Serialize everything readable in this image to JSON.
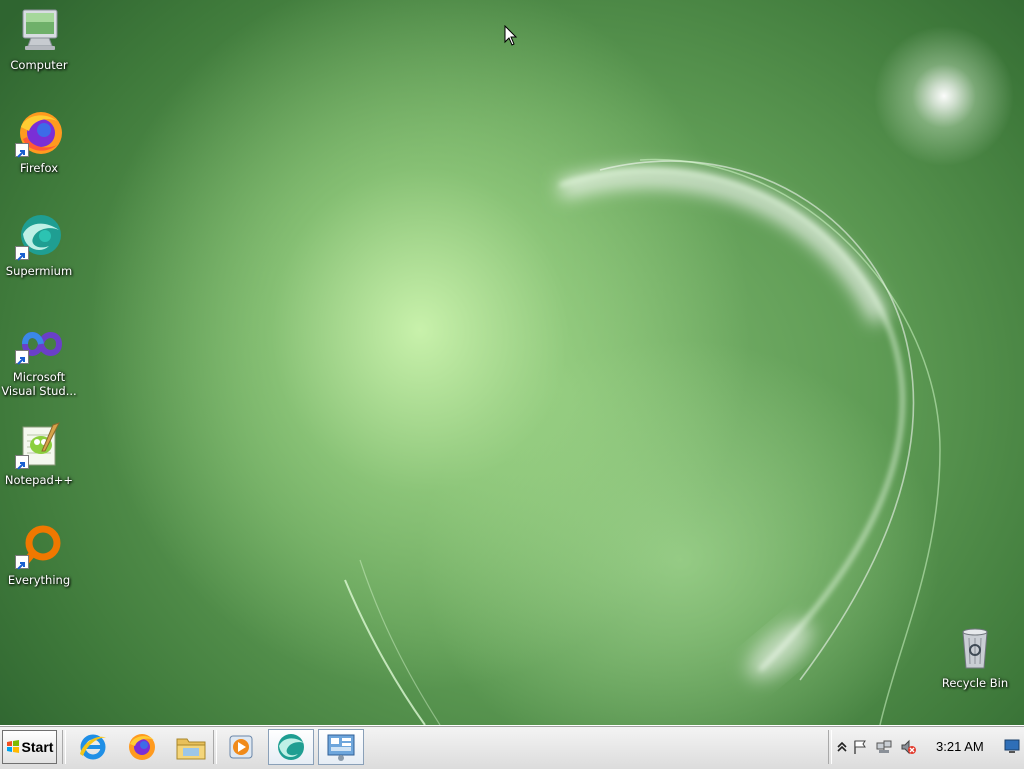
{
  "desktop": {
    "icons": [
      {
        "label": "Computer"
      },
      {
        "label": "Firefox"
      },
      {
        "label": "Supermium"
      },
      {
        "label_line1": "Microsoft",
        "label_line2": "Visual Stud..."
      },
      {
        "label": "Notepad++"
      },
      {
        "label": "Everything"
      },
      {
        "label": "Recycle Bin"
      }
    ]
  },
  "taskbar": {
    "start_label": "Start",
    "pinned": [
      {
        "icon": "internet-explorer-icon"
      },
      {
        "icon": "firefox-icon"
      },
      {
        "icon": "file-explorer-icon"
      },
      {
        "icon": "media-player-icon"
      },
      {
        "icon": "supermium-icon"
      },
      {
        "icon": "control-panel-icon"
      }
    ],
    "tray": {
      "clock": "3:21 AM"
    }
  },
  "colors": {
    "taskbar_bg": "#e8e8e8",
    "desktop_accent": "#5f9c55",
    "firefox_orange": "#ff8a1f",
    "everything_orange": "#f07800"
  }
}
